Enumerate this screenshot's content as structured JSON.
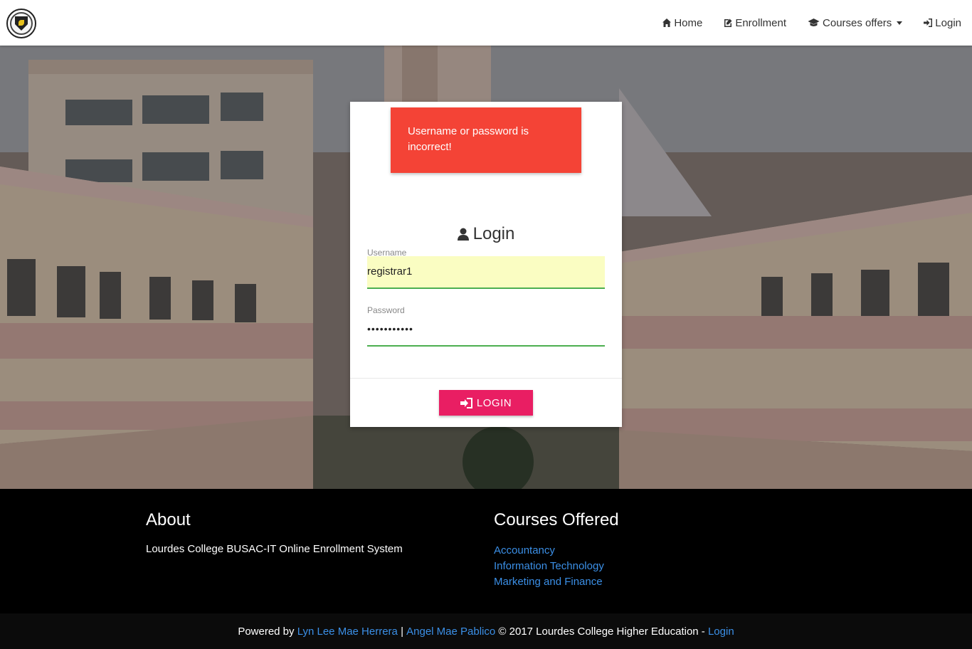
{
  "nav": {
    "items": [
      {
        "label": "Home",
        "icon": "home-icon"
      },
      {
        "label": "Enrollment",
        "icon": "edit-icon"
      },
      {
        "label": "Courses offers",
        "icon": "graduation-cap-icon"
      },
      {
        "label": "Login",
        "icon": "sign-in-icon"
      }
    ]
  },
  "alert": {
    "message": "Username or password is incorrect!",
    "color": "#f44336"
  },
  "login": {
    "title": "Login",
    "username_label": "Username",
    "username_value": "registrar1",
    "password_label": "Password",
    "password_value": "•••••••••••",
    "button_label": "LOGIN",
    "button_color": "#e91e63"
  },
  "footer": {
    "about_heading": "About",
    "about_text": "Lourdes College BUSAC-IT Online Enrollment System",
    "courses_heading": "Courses Offered",
    "courses": [
      "Accountancy",
      "Information Technology",
      "Marketing and Finance"
    ]
  },
  "bottom": {
    "powered_by": "Powered by",
    "author1": "Lyn Lee Mae Herrera",
    "sep": "|",
    "author2": "Angel Mae Pablico",
    "copyright": "© 2017 Lourdes College Higher Education -",
    "login_link": "Login"
  }
}
